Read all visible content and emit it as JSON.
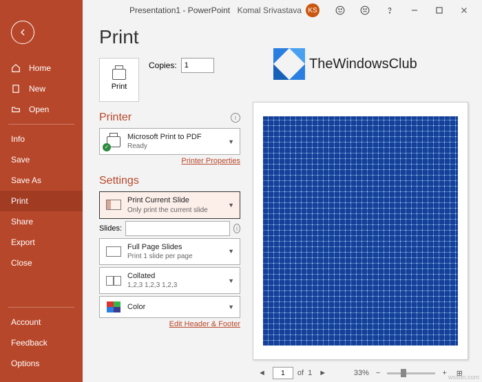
{
  "title": {
    "doc": "Presentation1  -  PowerPoint"
  },
  "user": {
    "name": "Komal Srivastava",
    "initials": "KS"
  },
  "sidebar": {
    "top": [
      {
        "label": "Home"
      },
      {
        "label": "New"
      },
      {
        "label": "Open"
      }
    ],
    "mid": [
      {
        "label": "Info"
      },
      {
        "label": "Save"
      },
      {
        "label": "Save As"
      },
      {
        "label": "Print"
      },
      {
        "label": "Share"
      },
      {
        "label": "Export"
      },
      {
        "label": "Close"
      }
    ],
    "bottom": [
      {
        "label": "Account"
      },
      {
        "label": "Feedback"
      },
      {
        "label": "Options"
      }
    ]
  },
  "heading": "Print",
  "print_btn": "Print",
  "copies": {
    "label": "Copies:",
    "value": "1"
  },
  "printer": {
    "heading": "Printer",
    "name": "Microsoft Print to PDF",
    "status": "Ready",
    "link": "Printer Properties"
  },
  "settings": {
    "heading": "Settings",
    "range": {
      "t1": "Print Current Slide",
      "t2": "Only print the current slide"
    },
    "slides_label": "Slides:",
    "layout": {
      "t1": "Full Page Slides",
      "t2": "Print 1 slide per page"
    },
    "collate": {
      "t1": "Collated",
      "t2": "1,2,3   1,2,3   1,2,3"
    },
    "color": {
      "t1": "Color"
    },
    "link": "Edit Header & Footer"
  },
  "logo_text": "TheWindowsClub",
  "footer": {
    "page": "1",
    "of_label": "of",
    "total": "1",
    "zoom": "33%"
  },
  "watermark": "wsxdn.com"
}
